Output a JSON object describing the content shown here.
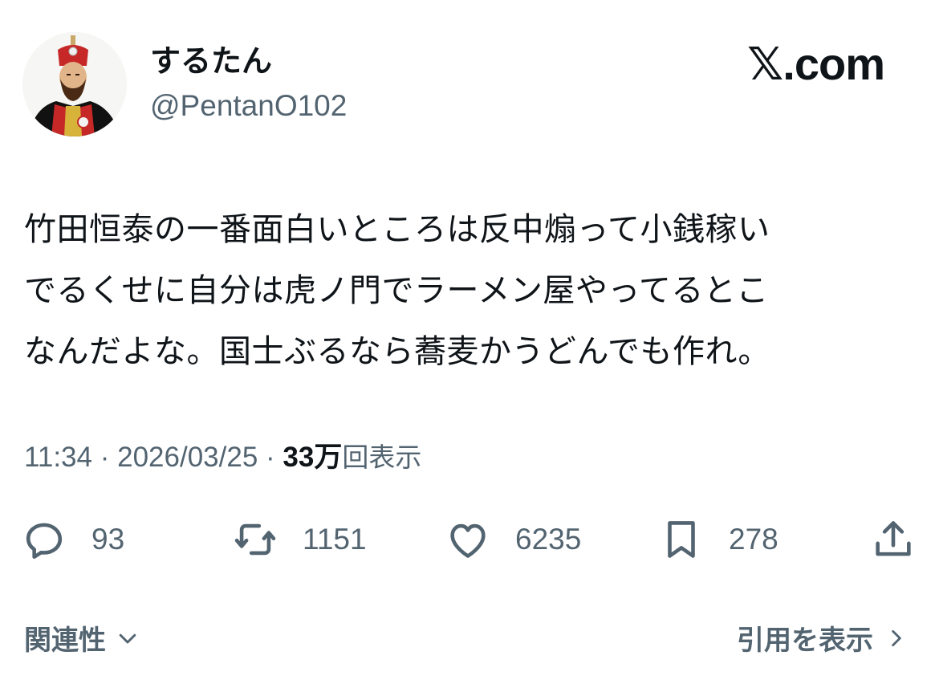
{
  "author": {
    "display_name": "するたん",
    "handle": "@PentanO102"
  },
  "brand": {
    "label": "𝕏.com"
  },
  "tweet": {
    "text": "竹田恒泰の一番面白いところは反中煽って小銭稼い\nでるくせに自分は虎ノ門でラーメン屋やってるとこ\nなんだよな。国士ぶるなら蕎麦かうどんでも作れ。"
  },
  "meta": {
    "time": "11:34",
    "separator": " · ",
    "date": "2026/03/25",
    "views_count": "33万",
    "views_label": "回表示"
  },
  "actions": {
    "replies": {
      "icon": "reply-icon",
      "count": "93"
    },
    "reposts": {
      "icon": "repost-icon",
      "count": "1151"
    },
    "likes": {
      "icon": "heart-icon",
      "count": "6235"
    },
    "bookmarks": {
      "icon": "bookmark-icon",
      "count": "278"
    },
    "share": {
      "icon": "share-icon"
    }
  },
  "footer": {
    "relevance_label": "関連性",
    "quotes_label": "引用を表示"
  },
  "colors": {
    "text": "#0f1419",
    "secondary": "#536471"
  }
}
